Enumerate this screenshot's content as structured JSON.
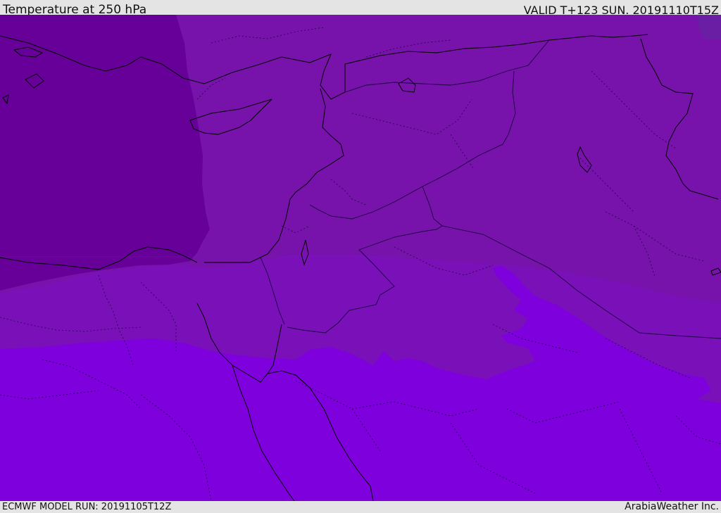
{
  "header": {
    "title": "Temperature at 250 hPa",
    "valid_time": "VALID T+123 SUN. 20191110T15Z"
  },
  "footer": {
    "model_run": "ECMWF MODEL RUN: 20191105T12Z",
    "credit": "ArabiaWeather Inc."
  },
  "map": {
    "field": "Temperature",
    "level": "250 hPa",
    "colors": {
      "coldest": "#670099",
      "cold": "#7712aa",
      "mid": "#7a10b8",
      "warm": "#7e00dc",
      "coastline": "#000000",
      "border": "#1a0040"
    }
  }
}
